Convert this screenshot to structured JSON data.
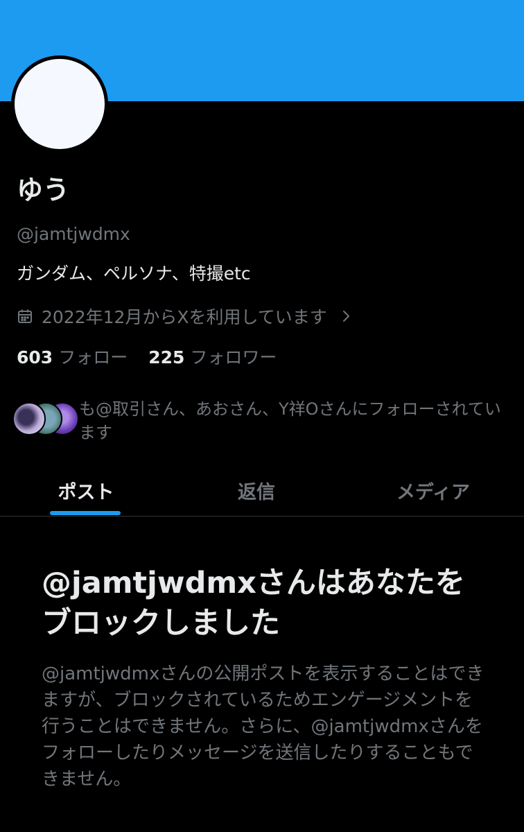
{
  "colors": {
    "banner": "#1d9bf0",
    "accent": "#1d9bf0",
    "background": "#000000",
    "text_primary": "#e7e9ea",
    "text_secondary": "#71767b"
  },
  "profile": {
    "display_name": "ゆう",
    "handle": "@jamtjwdmx",
    "bio": "ガンダム、ペルソナ、特撮etc",
    "joined_icon": "calendar-icon",
    "joined": "2022年12月からXを利用しています",
    "joined_chevron_icon": "chevron-right-icon",
    "following_count": "603",
    "following_label": "フォロー",
    "followers_count": "225",
    "followers_label": "フォロワー",
    "followed_by": "も@取引さん、あおさん、Y祥Oさんにフォローされています"
  },
  "tabs": [
    {
      "label": "ポスト",
      "active": true
    },
    {
      "label": "返信",
      "active": false
    },
    {
      "label": "メディア",
      "active": false
    }
  ],
  "blocked": {
    "title": "@jamtjwdmxさんはあなたをブロックしました",
    "body": "@jamtjwdmxさんの公開ポストを表示することはできますが、ブロックされているためエンゲージメントを行うことはできません。さらに、@jamtjwdmxさんをフォローしたりメッセージを送信したりすることもできません。"
  }
}
